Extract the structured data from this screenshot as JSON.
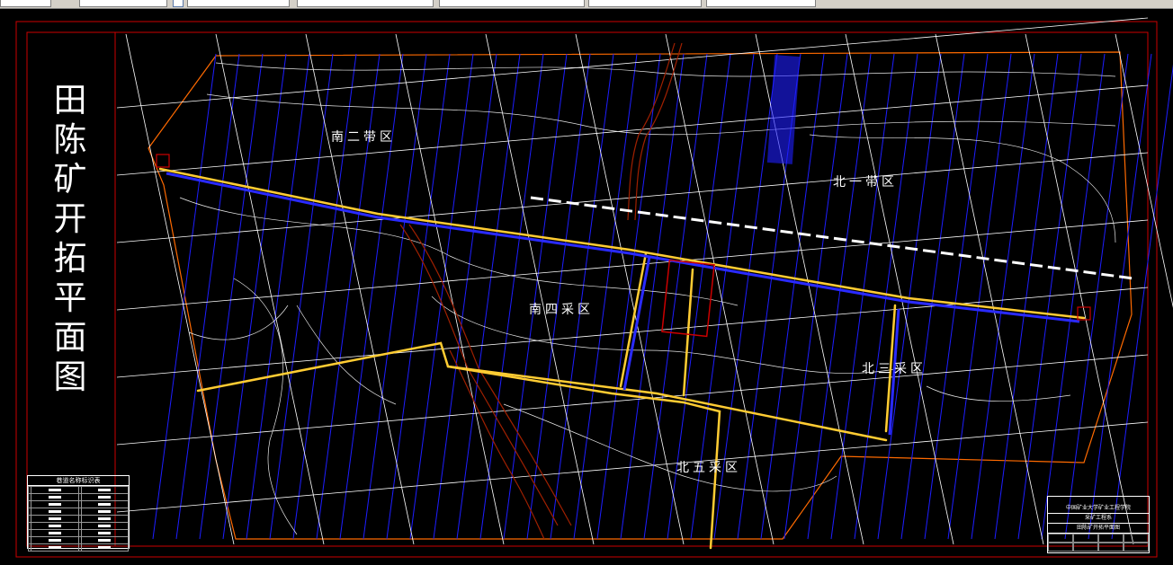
{
  "map": {
    "title": "田陈矿开拓平面图",
    "zones": {
      "south_two": "南二带区",
      "north_one": "北一带区",
      "south_four": "南四采区",
      "north_three": "北三采区",
      "north_five": "北五采区"
    }
  },
  "legend": {
    "title": "巷道名称标识表"
  },
  "title_block": {
    "org": "中国矿业大学矿业工程学院",
    "dept": "采矿工程系",
    "drawing_name": "田陈矿开拓平面图"
  },
  "colors": {
    "background": "#000000",
    "border": "#cc0000",
    "grid": "#ffffff",
    "seam_lines": "#1e1eff",
    "roadway": "#ffcc33",
    "boundary": "#ff6a00",
    "fault": "#a02000"
  }
}
